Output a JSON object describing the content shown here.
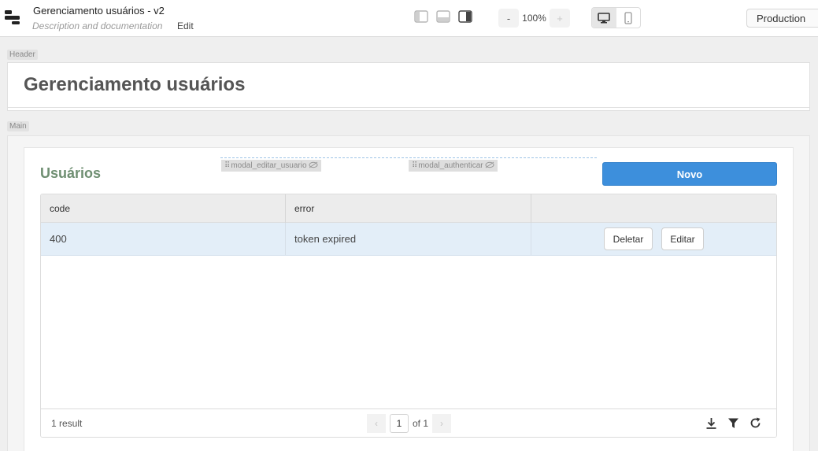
{
  "topbar": {
    "app_title": "Gerenciamento usuários - v2",
    "app_description": "Description and documentation",
    "edit_label": "Edit",
    "zoom_out_label": "-",
    "zoom_value": "100%",
    "zoom_in_label": "+",
    "environment": "Production",
    "layout_icons": [
      "sidebar-left-icon",
      "panel-bottom-icon",
      "sidebar-right-icon"
    ],
    "device_icons": [
      "desktop-icon",
      "mobile-icon"
    ]
  },
  "canvas": {
    "header_label": "Header",
    "main_label": "Main"
  },
  "header": {
    "page_title": "Gerenciamento usuários"
  },
  "main": {
    "section_title": "Usuários",
    "modals": [
      "modal_editar_usuario",
      "modal_authenticar"
    ],
    "new_button": "Novo",
    "table": {
      "columns": [
        "code",
        "error",
        ""
      ],
      "rows": [
        {
          "code": "400",
          "error": "token expired",
          "actions": [
            "Deletar",
            "Editar"
          ]
        }
      ],
      "result_count": "1 result",
      "pagination": {
        "current": "1",
        "of_label": "of 1",
        "prev": "‹",
        "next": "›"
      },
      "footer_icons": [
        "download-icon",
        "filter-icon",
        "refresh-icon"
      ]
    }
  },
  "colors": {
    "accent": "#3d8fdc",
    "section_title": "#6f8f72",
    "selected_row": "#e3eef8"
  }
}
